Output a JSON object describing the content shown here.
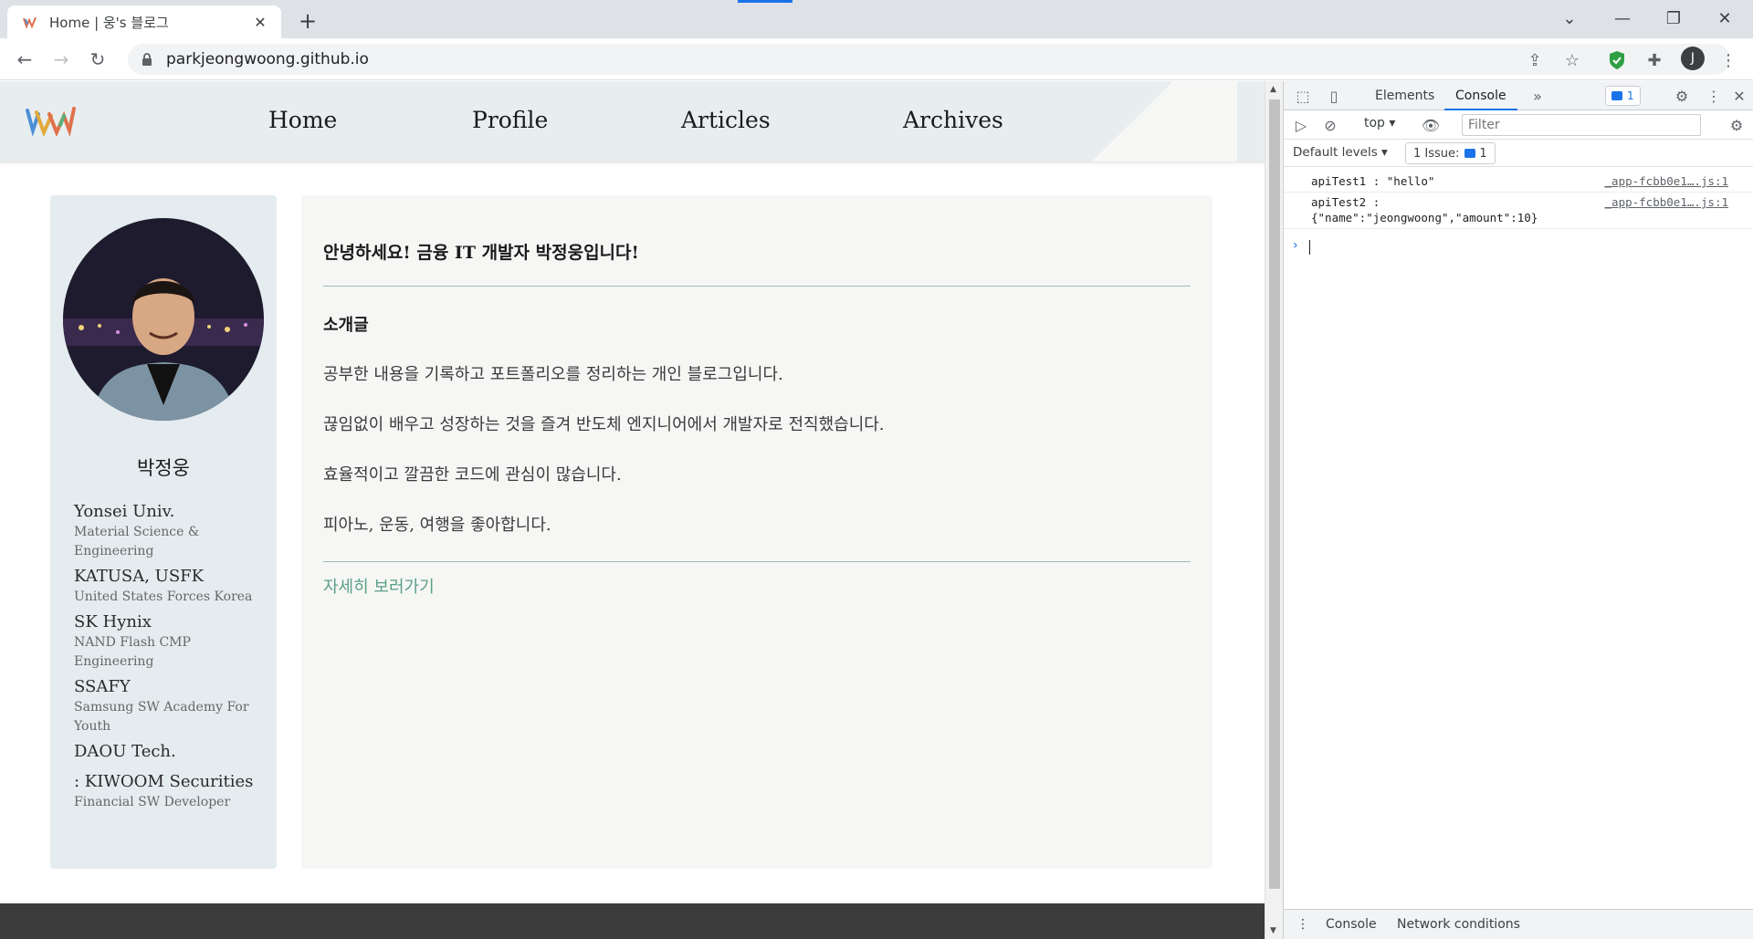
{
  "browser": {
    "tab_title": "Home | 웅's 블로그",
    "url": "parkjeongwoong.github.io",
    "profile_initial": "J"
  },
  "site": {
    "nav": [
      "Home",
      "Profile",
      "Articles",
      "Archives"
    ],
    "profile": {
      "name": "박정웅",
      "career": [
        {
          "title": "Yonsei Univ.",
          "sub": "Material Science & Engineering"
        },
        {
          "title": "KATUSA, USFK",
          "sub": "United States Forces Korea"
        },
        {
          "title": "SK Hynix",
          "sub": "NAND Flash CMP Engineering"
        },
        {
          "title": "SSAFY",
          "sub": "Samsung SW Academy For Youth"
        },
        {
          "title": "DAOU Tech.",
          "sub": ""
        },
        {
          "title": ": KIWOOM Securities",
          "sub": "Financial SW Developer"
        }
      ]
    },
    "content": {
      "greeting": "안녕하세요! 금융 IT 개발자 박정웅입니다!",
      "intro_heading": "소개글",
      "paragraphs": [
        "공부한 내용을 기록하고 포트폴리오를 정리하는 개인 블로그입니다.",
        "끊임없이 배우고 성장하는 것을 즐겨 반도체 엔지니어에서 개발자로 전직했습니다.",
        "효율적이고 깔끔한 코드에 관심이 많습니다.",
        "피아노, 운동, 여행을 좋아합니다."
      ],
      "more_link": "자세히 보러가기"
    }
  },
  "devtools": {
    "tabs": [
      "Elements",
      "Console"
    ],
    "active_tab": "Console",
    "issues_badge": "1",
    "context": "top",
    "filter_placeholder": "Filter",
    "levels": "Default levels",
    "issue_button": "1 Issue:",
    "issue_count": "1",
    "logs": [
      {
        "text": "apiTest1 : \"hello\"",
        "text2": "",
        "source": "_app-fcbb0e1….js:1"
      },
      {
        "text": "apiTest2 :",
        "text2": "{\"name\":\"jeongwoong\",\"amount\":10}",
        "source": "_app-fcbb0e1….js:1"
      }
    ],
    "drawer_tabs": [
      "Console",
      "Network conditions"
    ]
  },
  "colors": {
    "header_bg": "#e8eef0",
    "sidebar_bg": "#e5ecef",
    "content_bg": "#f6f7f5",
    "link_green": "#5a9e86",
    "footer": "#3c3c3c",
    "devtools_accent": "#1a73e8"
  },
  "icons": [
    "favicon-logo",
    "close-icon",
    "plus-icon",
    "back-icon",
    "forward-icon",
    "reload-icon",
    "lock-icon",
    "share-icon",
    "star-icon",
    "shield-extension-icon",
    "puzzle-icon",
    "kebab-menu-icon",
    "inspect-icon",
    "device-icon",
    "gear-icon",
    "eye-icon",
    "clear-icon"
  ]
}
